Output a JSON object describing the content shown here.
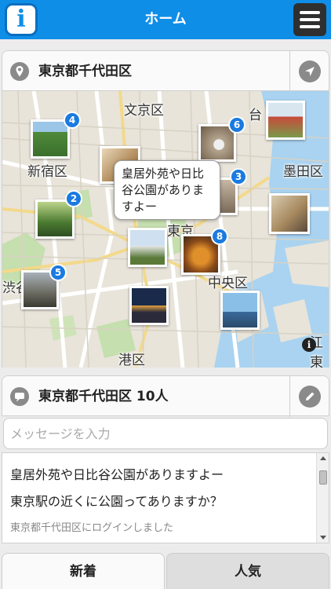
{
  "header": {
    "info_icon": "info-icon",
    "title": "ホーム",
    "menu_icon": "hamburger-menu-icon"
  },
  "location": {
    "title": "東京都千代田区",
    "pin_icon": "map-pin-icon",
    "nav_icon": "navigation-arrow-icon"
  },
  "map": {
    "districts": [
      "文京区",
      "台",
      "新宿区",
      "墨田区",
      "東京",
      "中央区",
      "渋谷",
      "港区",
      "江東"
    ],
    "photo_counts": [
      "4",
      "6",
      "3",
      "2",
      "8",
      "5"
    ],
    "bubble_text": "皇居外苑や日比谷公園がありますよー",
    "info_icon": "map-info-icon"
  },
  "chat": {
    "title": "東京都千代田区 10人",
    "chat_icon": "speech-bubble-icon",
    "edit_icon": "pencil-icon"
  },
  "message_input": {
    "placeholder": "メッセージを入力",
    "value": ""
  },
  "messages": [
    {
      "text": "皇居外苑や日比谷公園がありますよー",
      "type": "user"
    },
    {
      "text": "東京駅の近くに公園ってありますか？",
      "type": "user"
    },
    {
      "text": "東京都千代田区にログインしました",
      "type": "system"
    }
  ],
  "tabs": {
    "new": "新着",
    "popular": "人気"
  },
  "colors": {
    "header_bg": "#0f8ee8",
    "badge": "#1a7ae0",
    "water": "#a9d3f0"
  }
}
